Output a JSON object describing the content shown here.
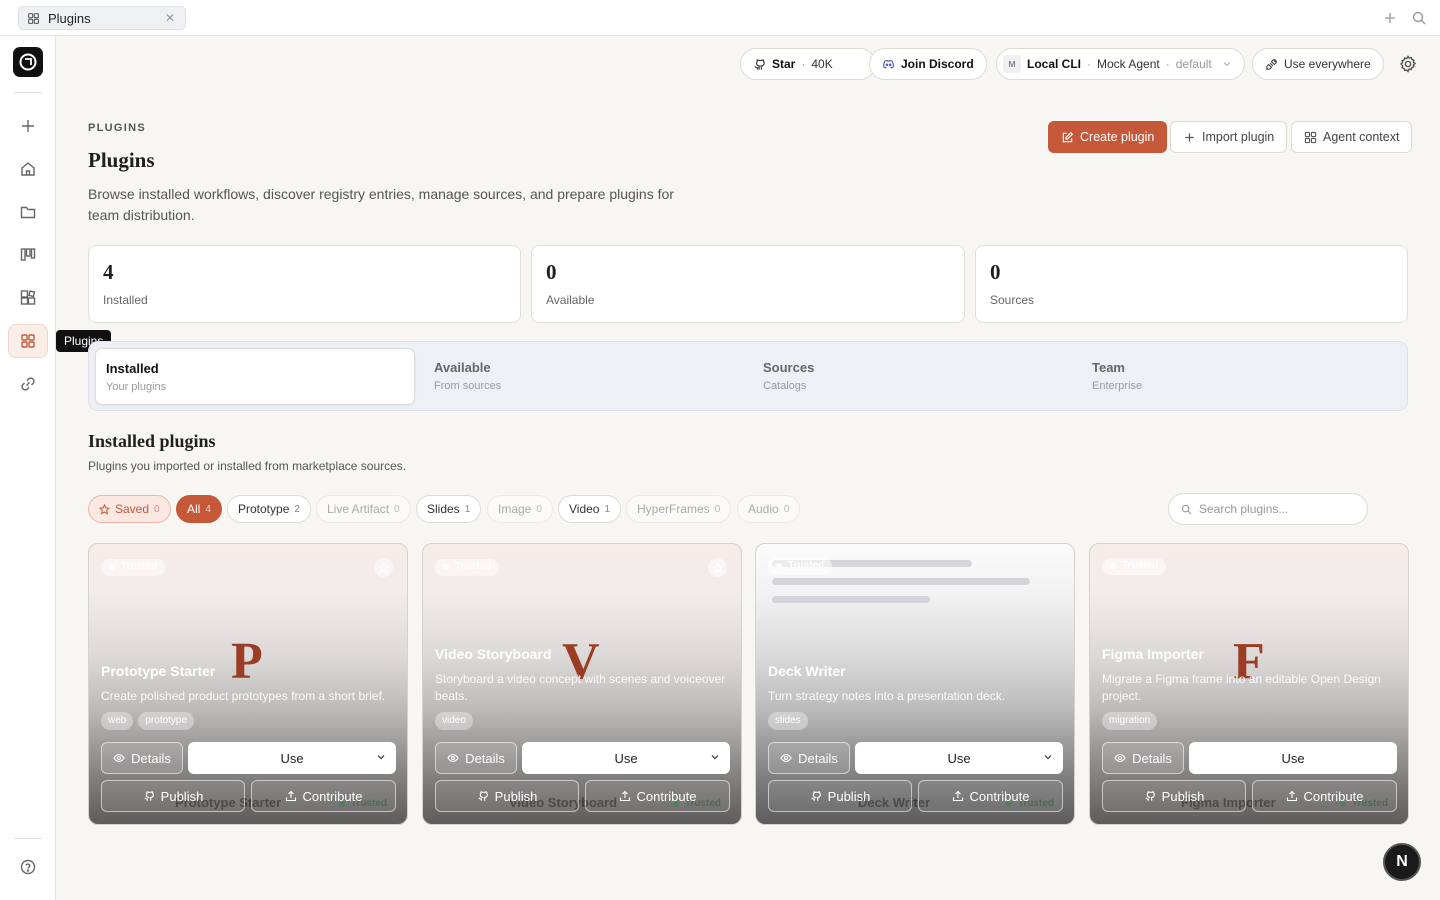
{
  "tab": {
    "label": "Plugins"
  },
  "header": {
    "star": {
      "label": "Star",
      "count": "40K"
    },
    "discord": {
      "label": "Join Discord"
    },
    "agent": {
      "name": "Local CLI",
      "agent": "Mock Agent",
      "profile": "default"
    },
    "use_everywhere": "Use everywhere"
  },
  "rail": {
    "tooltip": "Plugins"
  },
  "page": {
    "eyebrow": "PLUGINS",
    "title": "Plugins",
    "description": "Browse installed workflows, discover registry entries, manage sources, and prepare plugins for team distribution.",
    "actions": {
      "create": "Create plugin",
      "import": "Import plugin",
      "context": "Agent context"
    }
  },
  "stats": [
    {
      "value": "4",
      "label": "Installed"
    },
    {
      "value": "0",
      "label": "Available"
    },
    {
      "value": "0",
      "label": "Sources"
    }
  ],
  "segments": [
    {
      "title": "Installed",
      "sub": "Your plugins"
    },
    {
      "title": "Available",
      "sub": "From sources"
    },
    {
      "title": "Sources",
      "sub": "Catalogs"
    },
    {
      "title": "Team",
      "sub": "Enterprise"
    }
  ],
  "section": {
    "title": "Installed plugins",
    "subtitle": "Plugins you imported or installed from marketplace sources."
  },
  "filters": [
    {
      "label": "Saved",
      "count": "0"
    },
    {
      "label": "All",
      "count": "4"
    },
    {
      "label": "Prototype",
      "count": "2"
    },
    {
      "label": "Live Artifact",
      "count": "0"
    },
    {
      "label": "Slides",
      "count": "1"
    },
    {
      "label": "Image",
      "count": "0"
    },
    {
      "label": "Video",
      "count": "1"
    },
    {
      "label": "HyperFrames",
      "count": "0"
    },
    {
      "label": "Audio",
      "count": "0"
    }
  ],
  "search": {
    "placeholder": "Search plugins..."
  },
  "card_labels": {
    "trusted": "Trusted",
    "details": "Details",
    "use": "Use",
    "publish": "Publish",
    "contribute": "Contribute"
  },
  "cards": [
    {
      "letter": "P",
      "title": "Prototype Starter",
      "description": "Create polished product prototypes from a short brief.",
      "tags": [
        "web",
        "prototype"
      ]
    },
    {
      "letter": "V",
      "title": "Video Storyboard",
      "description": "Storyboard a video concept with scenes and voiceover beats.",
      "tags": [
        "video"
      ]
    },
    {
      "letter": "",
      "title": "Deck Writer",
      "description": "Turn strategy notes into a presentation deck.",
      "tags": [
        "slides"
      ]
    },
    {
      "letter": "F",
      "title": "Figma Importer",
      "description": "Migrate a Figma frame into an editable Open Design project.",
      "tags": [
        "migration"
      ]
    }
  ],
  "badge": {
    "label": "N"
  },
  "colors": {
    "accent": "#c6583a",
    "letter": "#9b3d24"
  }
}
